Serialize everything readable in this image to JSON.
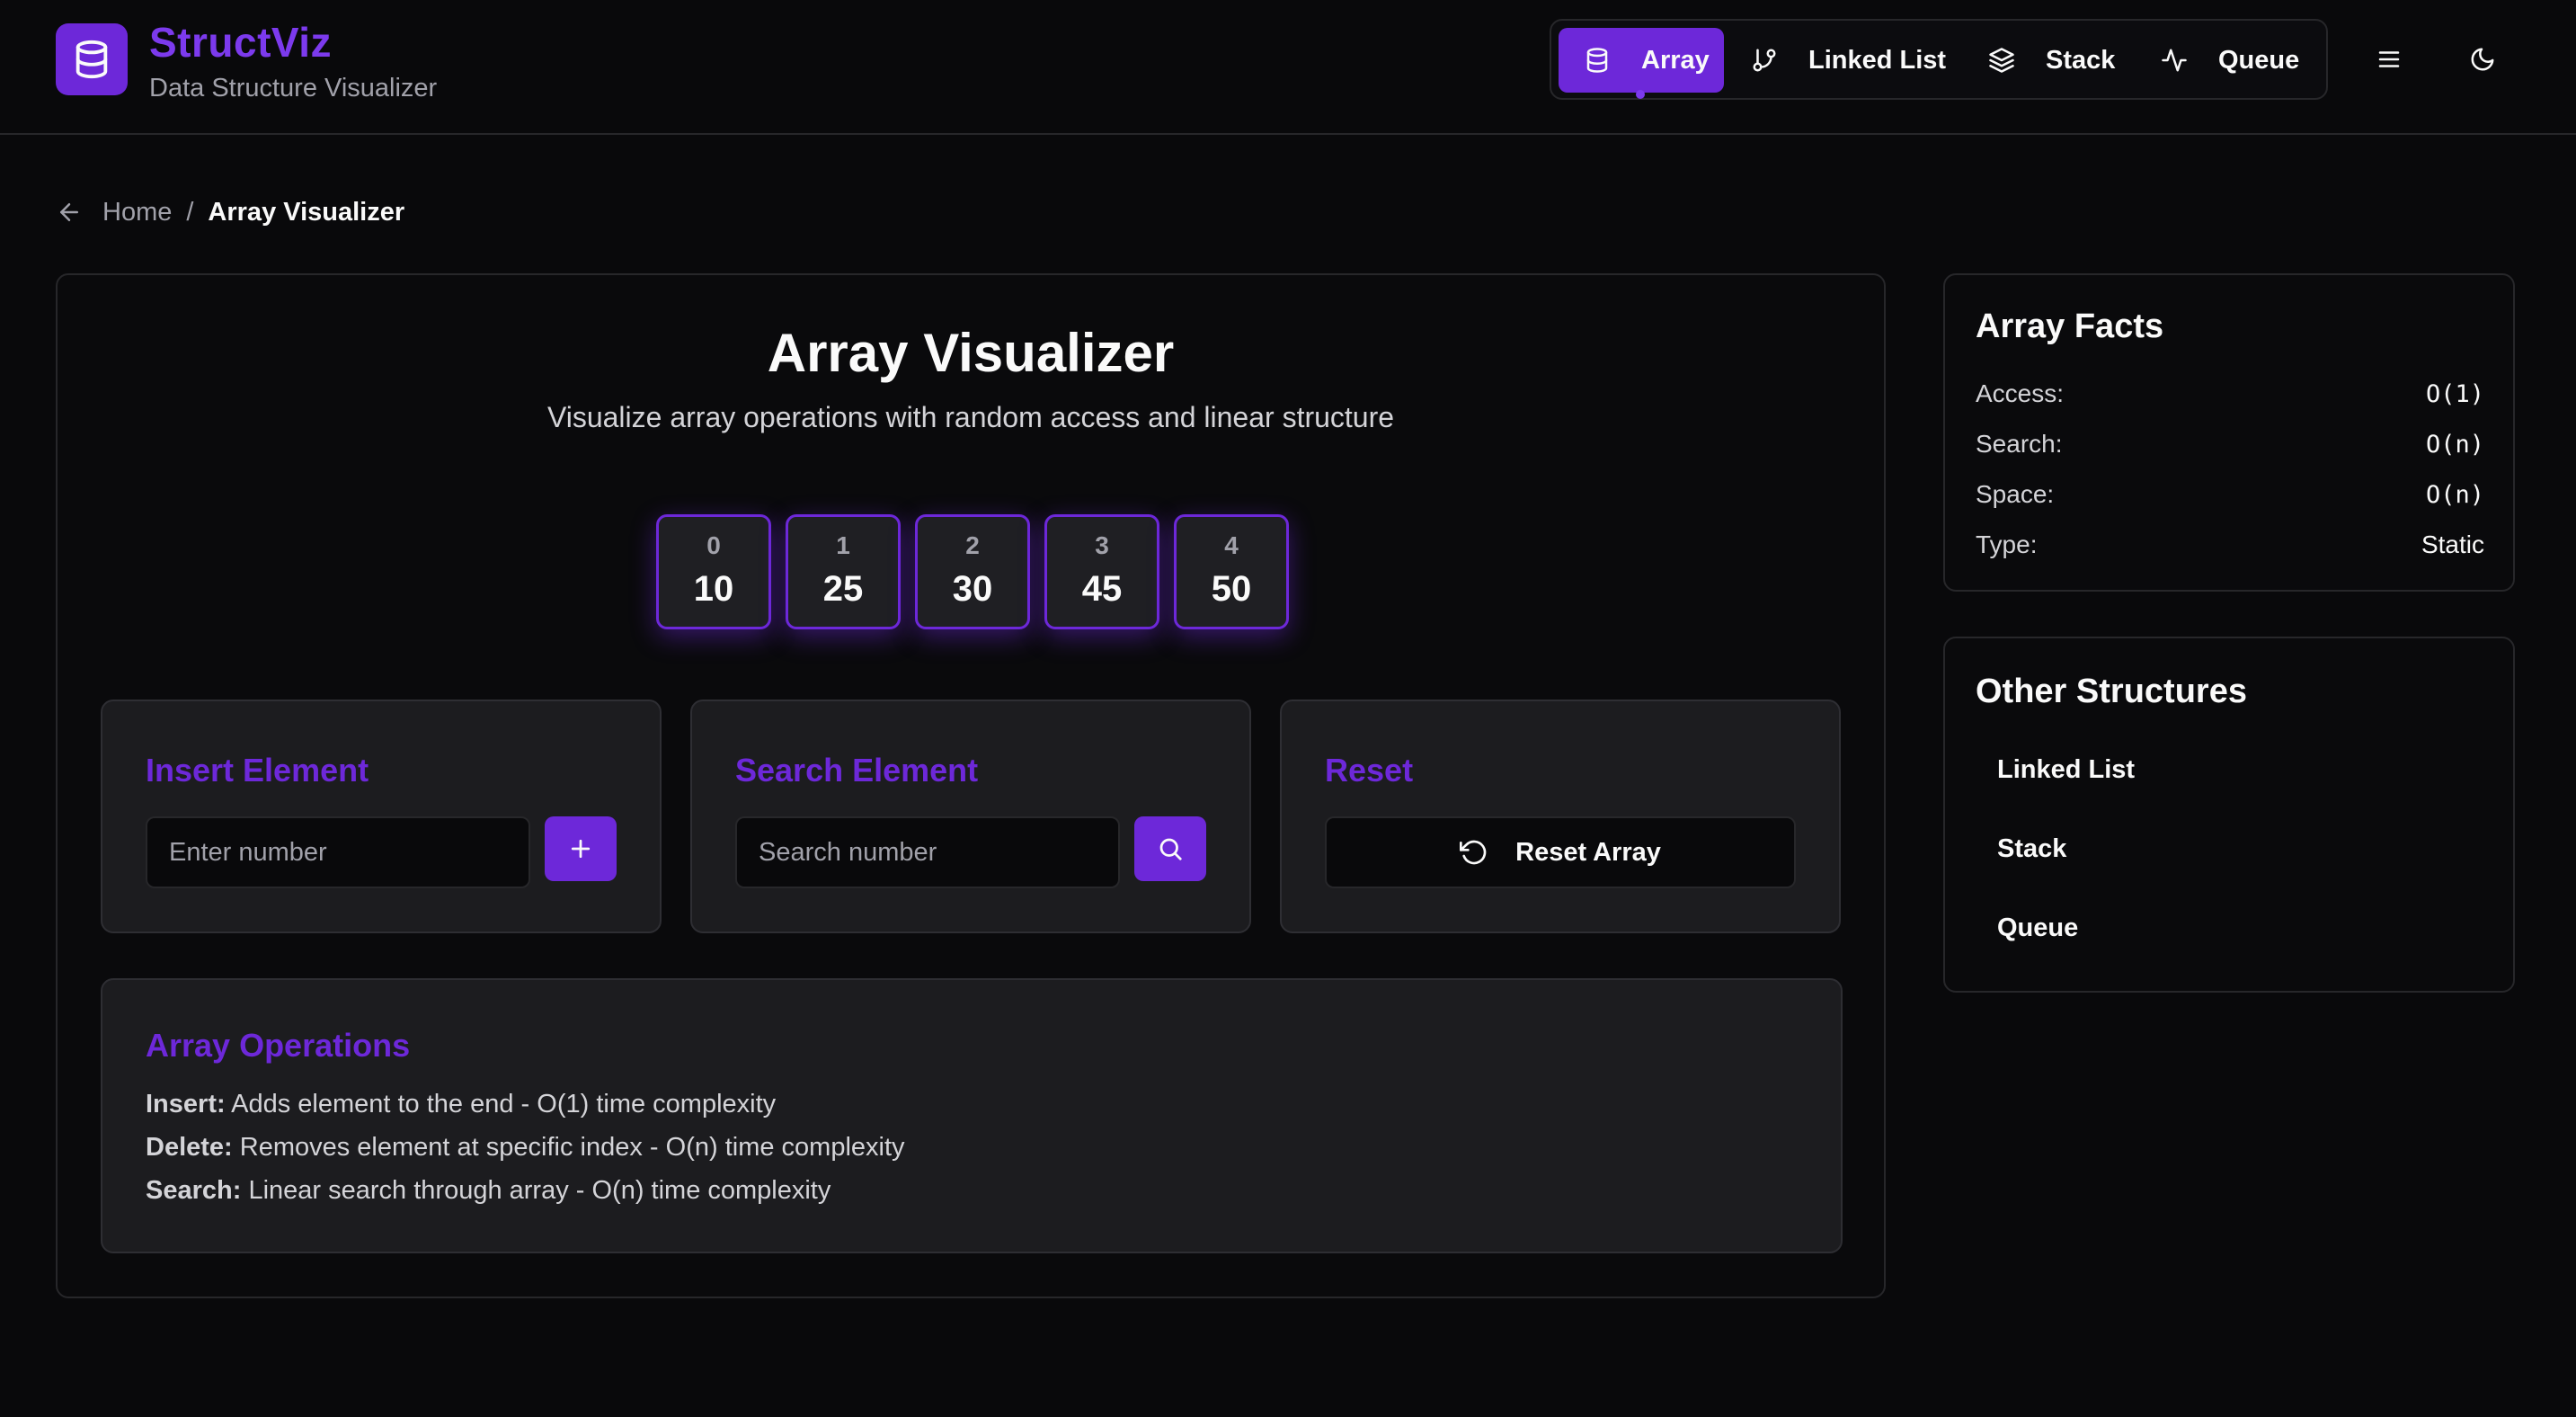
{
  "brand": {
    "title": "StructViz",
    "subtitle": "Data Structure Visualizer"
  },
  "nav": {
    "items": [
      {
        "label": "Array",
        "icon": "database-icon",
        "active": true
      },
      {
        "label": "Linked List",
        "icon": "git-branch-icon",
        "active": false
      },
      {
        "label": "Stack",
        "icon": "layers-icon",
        "active": false
      },
      {
        "label": "Queue",
        "icon": "activity-icon",
        "active": false
      }
    ],
    "menu_icon": "menu-icon",
    "theme_icon": "moon-icon"
  },
  "breadcrumb": {
    "home": "Home",
    "separator": "/",
    "current": "Array Visualizer"
  },
  "main": {
    "title": "Array Visualizer",
    "subtitle": "Visualize array operations with random access and linear structure",
    "array": [
      {
        "index": "0",
        "value": "10"
      },
      {
        "index": "1",
        "value": "25"
      },
      {
        "index": "2",
        "value": "30"
      },
      {
        "index": "3",
        "value": "45"
      },
      {
        "index": "4",
        "value": "50"
      }
    ],
    "insert": {
      "title": "Insert Element",
      "placeholder": "Enter number"
    },
    "search": {
      "title": "Search Element",
      "placeholder": "Search number"
    },
    "reset": {
      "title": "Reset",
      "button": "Reset Array"
    },
    "operations": {
      "title": "Array Operations",
      "items": [
        {
          "name": "Insert:",
          "desc": "Adds element to the end - O(1) time complexity"
        },
        {
          "name": "Delete:",
          "desc": "Removes element at specific index - O(n) time complexity"
        },
        {
          "name": "Search:",
          "desc": "Linear search through array - O(n) time complexity"
        }
      ]
    }
  },
  "facts": {
    "title": "Array Facts",
    "rows": [
      {
        "key": "Access:",
        "value": "O(1)"
      },
      {
        "key": "Search:",
        "value": "O(n)"
      },
      {
        "key": "Space:",
        "value": "O(n)"
      },
      {
        "key": "Type:",
        "value": "Static"
      }
    ]
  },
  "others": {
    "title": "Other Structures",
    "items": [
      "Linked List",
      "Stack",
      "Queue"
    ]
  },
  "colors": {
    "accent": "#6d28d9",
    "background": "#09090b",
    "panel": "#1c1c1f",
    "border": "#27272a"
  }
}
